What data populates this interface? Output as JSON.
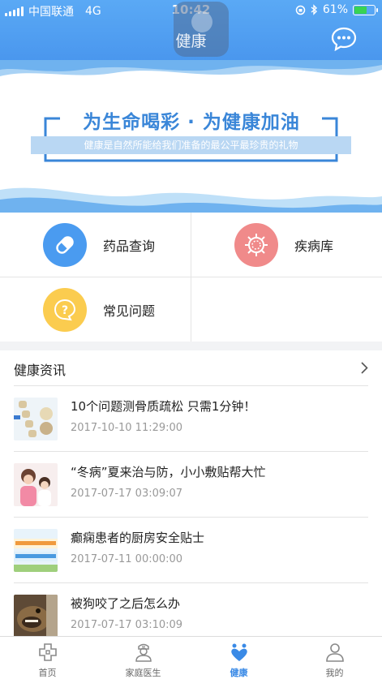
{
  "status_bar": {
    "carrier": "中国联通",
    "network": "4G",
    "time": "10:42",
    "battery": "61%",
    "battery_level": 0.61
  },
  "header": {
    "title": "健康",
    "chat_icon": "chat-bubble-icon"
  },
  "banner": {
    "slogan": "为生命喝彩 · 为健康加油",
    "subslogan": "健康是自然所能给我们准备的最公平最珍贵的礼物"
  },
  "grid": {
    "items": [
      {
        "label": "药品查询",
        "icon": "pill-icon",
        "color": "#4a9bf0"
      },
      {
        "label": "疾病库",
        "icon": "virus-icon",
        "color": "#f08a8a"
      },
      {
        "label": "常见问题",
        "icon": "question-icon",
        "color": "#fbcc4f"
      }
    ]
  },
  "news": {
    "title": "健康资讯",
    "items": [
      {
        "headline": "10个问题测骨质疏松 只需1分钟！",
        "date": "2017-10-10 11:29:00"
      },
      {
        "headline": "“冬病”夏来治与防，小小敷贴帮大忙",
        "date": "2017-07-17 03:09:07"
      },
      {
        "headline": "癫痫患者的厨房安全贴士",
        "date": "2017-07-11 00:00:00"
      },
      {
        "headline": "被狗咬了之后怎么办",
        "date": "2017-07-17 03:10:09"
      }
    ]
  },
  "tabs": [
    {
      "label": "首页",
      "icon": "home-cross-icon"
    },
    {
      "label": "家庭医生",
      "icon": "doctor-icon"
    },
    {
      "label": "健康",
      "icon": "heart-person-icon",
      "active": true
    },
    {
      "label": "我的",
      "icon": "profile-icon"
    }
  ],
  "colors": {
    "primary": "#4a97ee",
    "active_tab": "#3a8ae6"
  }
}
